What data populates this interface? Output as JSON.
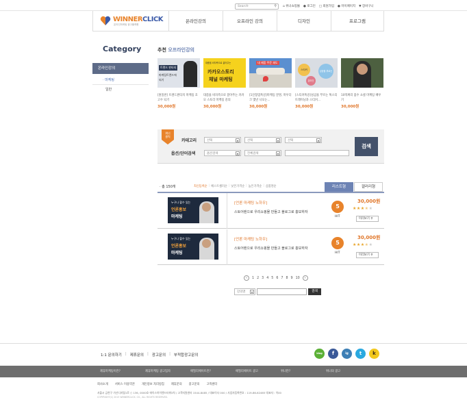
{
  "topbar": {
    "search_placeholder": "Search",
    "links": [
      "위너쇼핑몰",
      "로그인",
      "회원가입",
      "마이페이지",
      "장바구니"
    ]
  },
  "header": {
    "logo_text_winner": "WINNER",
    "logo_text_click": "CLICK",
    "logo_sub": "온라인마케팅 광고플랫폼",
    "nav": [
      "온라인강의",
      "오프라인 강의",
      "디자인",
      "프로그램"
    ]
  },
  "sidebar": {
    "title": "Category",
    "active": "온라인강의",
    "sub1": "· 마케팅",
    "sub2": "일반"
  },
  "recommend": {
    "title_prefix": "추천 ",
    "title_accent": "오프라인강의",
    "cards": [
      {
        "thumb_line1": "트렌드 판타지",
        "thumb_line2": "마케팅트렌드에",
        "thumb_line3": "되기",
        "title": "[원일반] 트렌드판타지 마케팅 초고수 되기",
        "price": "30,000원"
      },
      {
        "thumb_line1": "대중을 비자측으로 끌어주는",
        "thumb_line2": "카카오스토리",
        "thumb_line3": "채널 마케팅",
        "title": "대중을 비자측으로 끌어주는 카카오 스토리 마케팅 강의",
        "price": "30,000원"
      },
      {
        "thumb_line1": "내 제품 주문 쇄도",
        "thumb_line2": "",
        "thumb_line3": "",
        "title": "[1인창업특강]마케팅 분명, 마우더크 몇년 나오는...",
        "price": "30,000원"
      },
      {
        "thumb_line1": "스티커",
        "thumb_line2": "성공을 부르는",
        "thumb_line3": "온라인",
        "title": "[스티커특강]성공을 부르는 톡스티 트래이닝과 스티커...",
        "price": "30,000원"
      },
      {
        "thumb_line1": "",
        "thumb_line2": "",
        "thumb_line3": "",
        "title": "10억짜리 몸수 소셜 마케팅 배우기",
        "price": "30,000원"
      }
    ]
  },
  "search": {
    "badge_line1": "위너",
    "badge_line2": "클릭",
    "label_category": "카테고리",
    "label_option": "옵션/단어검색",
    "select1": "선택",
    "select2": "선택",
    "select3": "선택",
    "option_select": "옵션검색",
    "all_select": "전체검색",
    "button": "검색"
  },
  "list": {
    "total": "· 총 150개",
    "sort": [
      "최신등록순",
      "베스트셀러순",
      "낮은가격순",
      "높은가격순",
      "상품명순"
    ],
    "tab_list": "리스트형",
    "tab_gallery": "갤러리형",
    "rows": [
      {
        "img_line1": "누구나 할수 있는",
        "img_line2": "언론홍보",
        "img_line3": "마케팅",
        "title": "[언론 마케팅 노하우]",
        "desc": "스토어랜으로 우리쇼핑몰 만들고 블로그로 홍보하자",
        "hit": "5",
        "hit_label": "HIT",
        "price": "30,000원",
        "rating": 3.5,
        "preview": "미리보기"
      },
      {
        "img_line1": "누구나 할수 있는",
        "img_line2": "언론홍보",
        "img_line3": "마케팅",
        "title": "[언론 마케팅 노하우]",
        "desc": "스토어랜으로 우리쇼핑몰 만들고 블로그로 홍보하자",
        "hit": "5",
        "hit_label": "HIT",
        "price": "30,000원",
        "rating": 3.5,
        "preview": "미리보기"
      }
    ]
  },
  "pagination": {
    "pages": [
      "1",
      "2",
      "3",
      "4",
      "5",
      "6",
      "7",
      "8",
      "9",
      "10"
    ],
    "prev": "‹",
    "next": "›"
  },
  "bottom_search": {
    "select": "강의명",
    "button": "검색"
  },
  "footer": {
    "links": [
      "1:1 문의하기",
      "제휴문의",
      "광고문의",
      "부적합광고문의"
    ],
    "sns": [
      "blog",
      "f",
      "ig",
      "t",
      "k"
    ],
    "bar_items": [
      "제휴마케팅이란?",
      "제휴마케팅 광고업자",
      "애필리에이트란?",
      "애필리에이트 광고",
      "위너란?",
      "위너의 광고"
    ],
    "nav": [
      "회사소개",
      "서비스 이용약관",
      "개인정보 처리방침",
      "제휴문의",
      "광고문의",
      "고객센터"
    ],
    "address": "서울시 금천구 가산디지털1로 ○ 136, 0000호 에이스하이엔드타워3차 / 고객지원센터 1544-8485 / 대표이사 000 / 사업자등록번호 : 119-86-62465 대표자 : 이00",
    "copyright": "COPYRIGHT(C) 2015 WINNERCLICK. CO., ALL RIGHTS RESERVED."
  }
}
